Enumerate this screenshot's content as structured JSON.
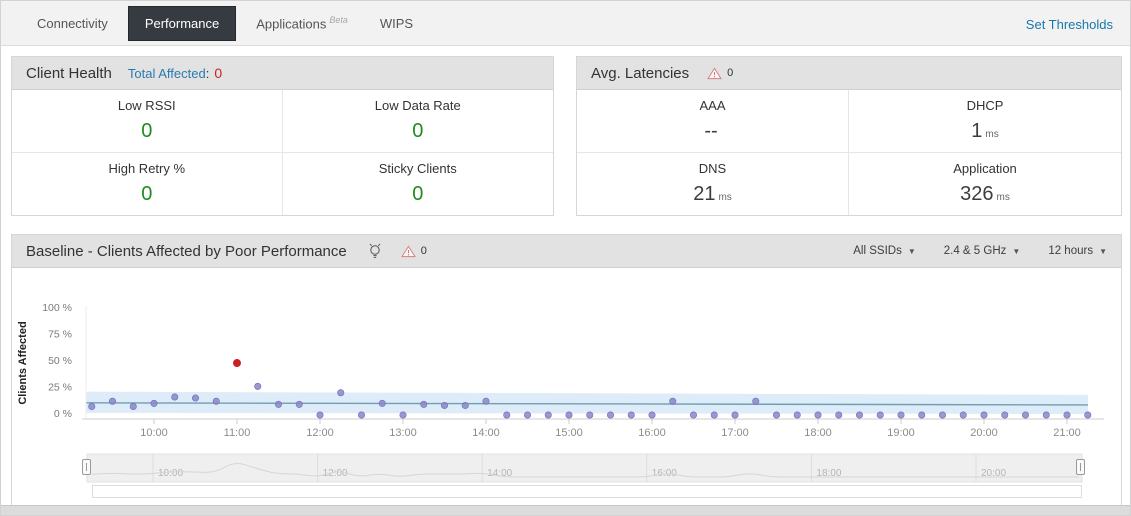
{
  "colors": {
    "link": "#1878a8",
    "positive": "#1f8c1f",
    "alert_red": "#cc2222",
    "active_tab_bg": "#363a41",
    "panel_header_bg": "#e2e2e2"
  },
  "tabs": {
    "items": [
      {
        "label": "Connectivity",
        "active": false
      },
      {
        "label": "Performance",
        "active": true
      },
      {
        "label": "Applications",
        "active": false,
        "badge": "Beta"
      },
      {
        "label": "WIPS",
        "active": false
      }
    ],
    "set_thresholds_label": "Set Thresholds"
  },
  "client_health": {
    "title": "Client Health",
    "total_affected_label": "Total Affected",
    "separator": ":",
    "total_affected_value": "0",
    "metrics": [
      {
        "label": "Low RSSI",
        "value": "0"
      },
      {
        "label": "Low Data Rate",
        "value": "0"
      },
      {
        "label": "High Retry %",
        "value": "0"
      },
      {
        "label": "Sticky Clients",
        "value": "0"
      }
    ]
  },
  "avg_latencies": {
    "title": "Avg. Latencies",
    "alert_count": "0",
    "metrics": [
      {
        "label": "AAA",
        "value": "--",
        "unit": ""
      },
      {
        "label": "DHCP",
        "value": "1",
        "unit": "ms"
      },
      {
        "label": "DNS",
        "value": "21",
        "unit": "ms"
      },
      {
        "label": "Application",
        "value": "326",
        "unit": "ms"
      }
    ]
  },
  "baseline": {
    "title": "Baseline - Clients Affected by Poor Performance",
    "alert_count": "0",
    "filters": [
      {
        "label": "All SSIDs"
      },
      {
        "label": "2.4 & 5 GHz"
      },
      {
        "label": "12 hours"
      }
    ]
  },
  "chart_data": {
    "type": "scatter",
    "title": "Baseline - Clients Affected by Poor Performance",
    "ylabel": "Clients Affected",
    "ylim": [
      0,
      100
    ],
    "yticks": [
      0,
      25,
      50,
      75,
      100
    ],
    "ytick_labels": [
      "0 %",
      "25 %",
      "50 %",
      "75 %",
      "100 %"
    ],
    "xtick_labels": [
      "10:00",
      "11:00",
      "12:00",
      "13:00",
      "14:00",
      "15:00",
      "16:00",
      "17:00",
      "18:00",
      "19:00",
      "20:00",
      "21:00"
    ],
    "x": [
      "09:15",
      "09:30",
      "09:45",
      "10:00",
      "10:15",
      "10:30",
      "10:45",
      "11:00",
      "11:15",
      "11:30",
      "11:45",
      "12:00",
      "12:15",
      "12:30",
      "12:45",
      "13:00",
      "13:15",
      "13:30",
      "13:45",
      "14:00",
      "14:15",
      "14:30",
      "14:45",
      "15:00",
      "15:15",
      "15:30",
      "15:45",
      "16:00",
      "16:15",
      "16:30",
      "16:45",
      "17:00",
      "17:15",
      "17:30",
      "17:45",
      "18:00",
      "18:15",
      "18:30",
      "18:45",
      "19:00",
      "19:15",
      "19:30",
      "19:45",
      "20:00",
      "20:15",
      "20:30",
      "20:45",
      "21:00",
      "21:15"
    ],
    "values": [
      8,
      13,
      8,
      11,
      17,
      16,
      13,
      49,
      27,
      10,
      10,
      0,
      21,
      0,
      11,
      0,
      10,
      9,
      9,
      13,
      0,
      0,
      0,
      0,
      0,
      0,
      0,
      0,
      13,
      0,
      0,
      0,
      13,
      0,
      0,
      0,
      0,
      0,
      0,
      0,
      0,
      0,
      0,
      0,
      0,
      0,
      0,
      0,
      0
    ],
    "anomaly_index": 7,
    "anomaly_color": "#cc1f1f",
    "point_color": "#8886c9",
    "point_stroke": "#6f6cb5",
    "baseline_band": {
      "upper_start": 22,
      "upper_end": 19,
      "lower_start": 2,
      "lower_end": 1,
      "color": "#ddecf8"
    },
    "baseline_line": {
      "start": 11.5,
      "end": 9.5,
      "color": "#6f9fb3"
    },
    "legend": "none",
    "grid": "off",
    "navigator": {
      "labels": [
        "10:00",
        "12:00",
        "14:00",
        "16:00",
        "18:00",
        "20:00"
      ]
    }
  }
}
